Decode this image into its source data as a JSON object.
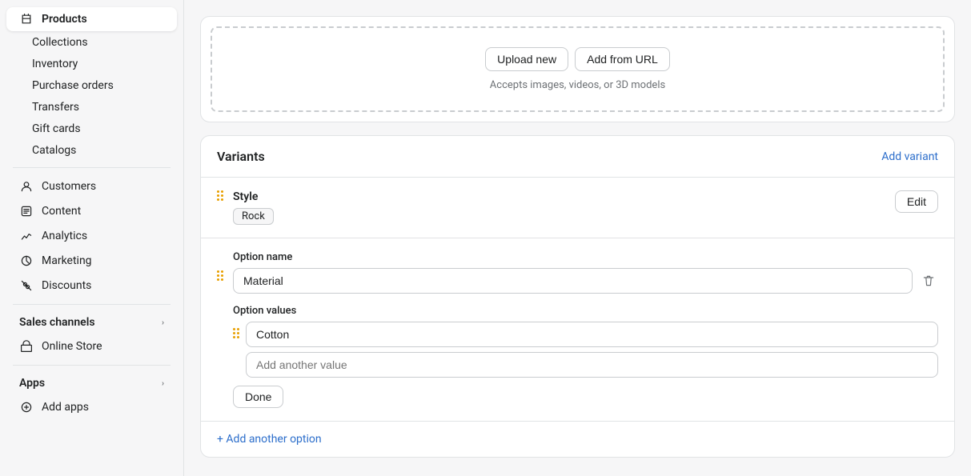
{
  "sidebar": {
    "products": {
      "label": "Products",
      "active": true,
      "sub_items": [
        {
          "label": "Collections",
          "name": "collections"
        },
        {
          "label": "Inventory",
          "name": "inventory"
        },
        {
          "label": "Purchase orders",
          "name": "purchase-orders"
        },
        {
          "label": "Transfers",
          "name": "transfers"
        },
        {
          "label": "Gift cards",
          "name": "gift-cards"
        },
        {
          "label": "Catalogs",
          "name": "catalogs"
        }
      ]
    },
    "main_items": [
      {
        "label": "Customers",
        "name": "customers",
        "icon": "person"
      },
      {
        "label": "Content",
        "name": "content",
        "icon": "content"
      },
      {
        "label": "Analytics",
        "name": "analytics",
        "icon": "analytics"
      },
      {
        "label": "Marketing",
        "name": "marketing",
        "icon": "marketing"
      },
      {
        "label": "Discounts",
        "name": "discounts",
        "icon": "discounts"
      }
    ],
    "sales_channels": {
      "label": "Sales channels",
      "items": [
        {
          "label": "Online Store",
          "name": "online-store",
          "icon": "store"
        }
      ]
    },
    "apps": {
      "label": "Apps",
      "add_apps_label": "Add apps"
    }
  },
  "upload_area": {
    "upload_new_label": "Upload new",
    "add_from_url_label": "Add from URL",
    "hint": "Accepts images, videos, or 3D models"
  },
  "variants": {
    "title": "Variants",
    "add_variant_label": "Add variant",
    "style": {
      "label": "Style",
      "badge": "Rock",
      "edit_label": "Edit"
    },
    "option": {
      "name_label": "Option name",
      "name_value": "Material",
      "values_label": "Option values",
      "value_1": "Cotton",
      "add_another_placeholder": "Add another value",
      "done_label": "Done"
    },
    "add_another_option_label": "+ Add another option"
  }
}
